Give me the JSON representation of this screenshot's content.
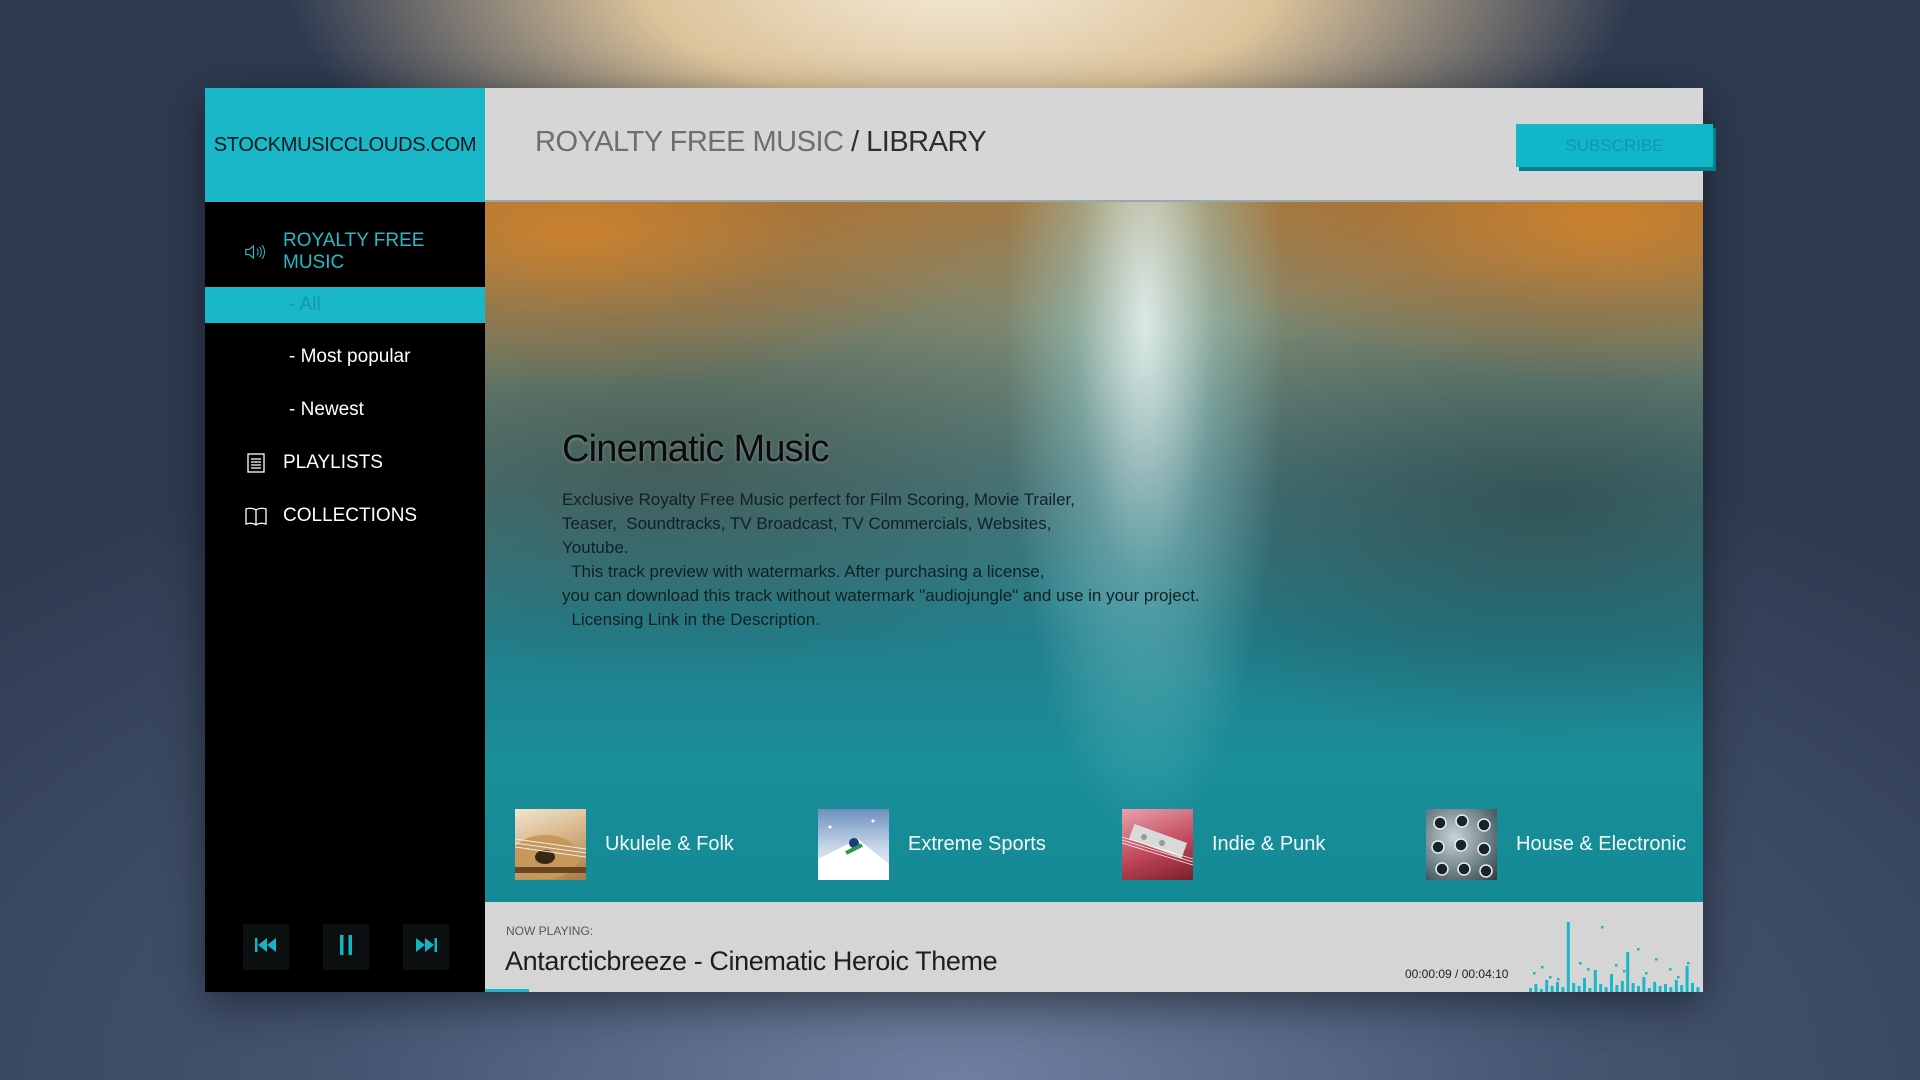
{
  "brand": {
    "name": "STOCKMUSICCLOUDS.COM"
  },
  "header": {
    "section": "ROYALTY FREE MUSIC",
    "separator": "/",
    "current": "LIBRARY",
    "subscribe_label": "SUBSCRIBE"
  },
  "sidebar": {
    "items": [
      {
        "label": "ROYALTY FREE MUSIC",
        "icon": "speaker-icon",
        "type": "primary"
      },
      {
        "label": "- All",
        "type": "sub",
        "active": true
      },
      {
        "label": "- Most popular",
        "type": "sub"
      },
      {
        "label": "- Newest",
        "type": "sub"
      },
      {
        "label": "PLAYLISTS",
        "icon": "list-icon",
        "type": "section"
      },
      {
        "label": "COLLECTIONS",
        "icon": "book-icon",
        "type": "section"
      }
    ]
  },
  "player": {
    "controls": [
      "previous-icon",
      "pause-icon",
      "next-icon"
    ]
  },
  "hero": {
    "title": "Cinematic Music",
    "description_lines": [
      "Exclusive Royalty Free Music perfect for Film Scoring, Movie Trailer,",
      "Teaser,  Soundtracks, TV Broadcast, TV Commercials, Websites,",
      "Youtube.",
      "  This track preview with watermarks. After purchasing a license,",
      "you can download this track without watermark \"audiojungle\" and use in your project.",
      "  Licensing Link in the Description."
    ]
  },
  "genres": [
    {
      "label": "Ukulele & Folk"
    },
    {
      "label": "Extreme Sports"
    },
    {
      "label": "Indie & Punk"
    },
    {
      "label": "House & Electronic"
    }
  ],
  "now_playing": {
    "label": "NOW PLAYING:",
    "title": "Antarcticbreeze - Cinematic Heroic Theme",
    "time": "00:00:09 / 00:04:10",
    "progress": 0.036
  },
  "colors": {
    "accent": "#19b7c7",
    "sidebar_bg": "#000000",
    "header_bg": "#d6d6d7"
  }
}
